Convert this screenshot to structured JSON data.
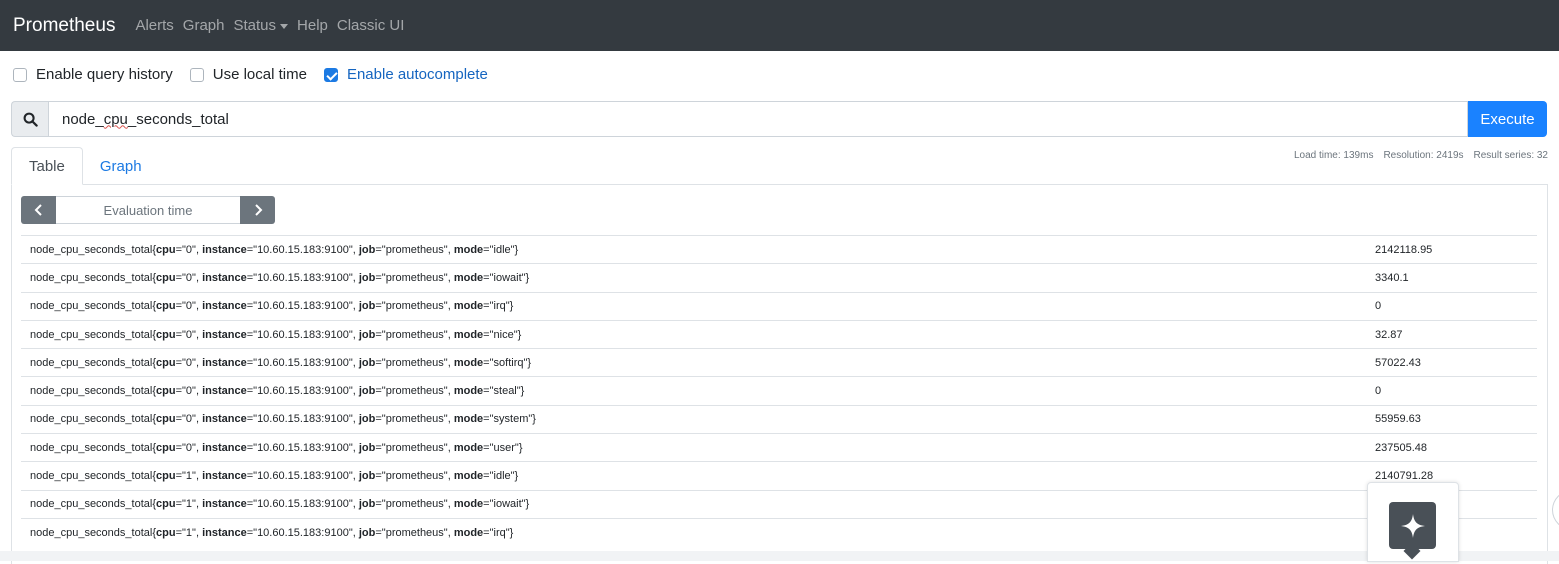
{
  "navbar": {
    "brand": "Prometheus",
    "links": [
      "Alerts",
      "Graph",
      "Status",
      "Help",
      "Classic UI"
    ]
  },
  "options": {
    "query_history": {
      "label": "Enable query history",
      "checked": false
    },
    "local_time": {
      "label": "Use local time",
      "checked": false
    },
    "autocomplete": {
      "label": "Enable autocomplete",
      "checked": true
    }
  },
  "query": {
    "value_prefix": "node_",
    "value_underlined": "cpu",
    "value_suffix": "_seconds_total",
    "execute_label": "Execute"
  },
  "stats": {
    "load_time": "Load time: 139ms",
    "resolution": "Resolution: 2419s",
    "result_series": "Result series: 32"
  },
  "tabs": {
    "table": "Table",
    "graph": "Graph"
  },
  "eval": {
    "placeholder": "Evaluation time"
  },
  "results": [
    {
      "cpu": "0",
      "instance": "10.60.15.183:9100",
      "job": "prometheus",
      "mode": "idle",
      "value": "2142118.95"
    },
    {
      "cpu": "0",
      "instance": "10.60.15.183:9100",
      "job": "prometheus",
      "mode": "iowait",
      "value": "3340.1"
    },
    {
      "cpu": "0",
      "instance": "10.60.15.183:9100",
      "job": "prometheus",
      "mode": "irq",
      "value": "0"
    },
    {
      "cpu": "0",
      "instance": "10.60.15.183:9100",
      "job": "prometheus",
      "mode": "nice",
      "value": "32.87"
    },
    {
      "cpu": "0",
      "instance": "10.60.15.183:9100",
      "job": "prometheus",
      "mode": "softirq",
      "value": "57022.43"
    },
    {
      "cpu": "0",
      "instance": "10.60.15.183:9100",
      "job": "prometheus",
      "mode": "steal",
      "value": "0"
    },
    {
      "cpu": "0",
      "instance": "10.60.15.183:9100",
      "job": "prometheus",
      "mode": "system",
      "value": "55959.63"
    },
    {
      "cpu": "0",
      "instance": "10.60.15.183:9100",
      "job": "prometheus",
      "mode": "user",
      "value": "237505.48"
    },
    {
      "cpu": "1",
      "instance": "10.60.15.183:9100",
      "job": "prometheus",
      "mode": "idle",
      "value": "2140791.28"
    },
    {
      "cpu": "1",
      "instance": "10.60.15.183:9100",
      "job": "prometheus",
      "mode": "iowait",
      "value": ""
    },
    {
      "cpu": "1",
      "instance": "10.60.15.183:9100",
      "job": "prometheus",
      "mode": "irq",
      "value": ""
    }
  ],
  "metric_name": "node_cpu_seconds_total",
  "icons": {
    "search": "search-icon",
    "prev": "chevron-left-icon",
    "next": "chevron-right-icon",
    "assistant": "sparkle-icon"
  },
  "colors": {
    "navbar": "#343a40",
    "accent": "#1a82ff",
    "checkbox_checked": "#1c7ae3"
  }
}
